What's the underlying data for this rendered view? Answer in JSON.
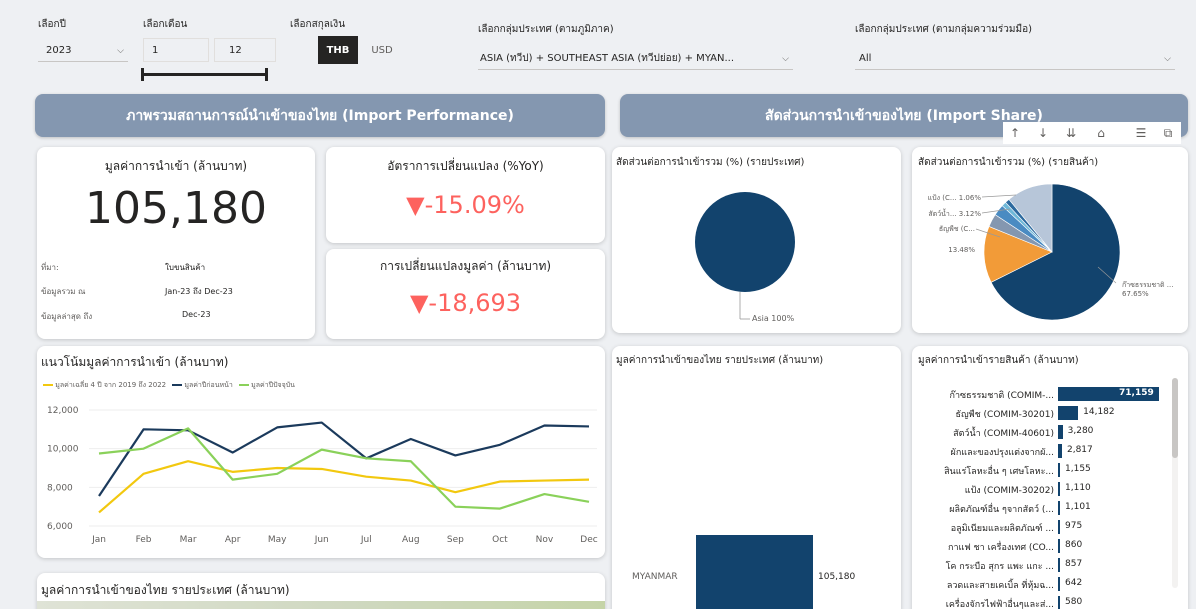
{
  "filters": {
    "year": {
      "label": "เลือกปี",
      "value": "2023"
    },
    "month": {
      "label": "เลือกเดือน",
      "from": "1",
      "to": "12"
    },
    "currency": {
      "label": "เลือกสกุลเงิน",
      "active": "THB",
      "inactive": "USD"
    },
    "region": {
      "label": "เลือกกลุ่มประเทศ (ตามภูมิภาค)",
      "value": "ASIA (ทวีป) + SOUTHEAST ASIA (ทวีปย่อย) + MYAN..."
    },
    "coop": {
      "label": "เลือกกลุ่มประเทศ (ตามกลุ่มความร่วมมือ)",
      "value": "All"
    }
  },
  "banners": {
    "left": "ภาพรวมสถานการณ์นำเข้าของไทย (Import Performance)",
    "right": "สัดส่วนการนำเข้าของไทย (Import Share)"
  },
  "kpi_value": {
    "title": "มูลค่าการนำเข้า (ล้านบาท)",
    "value": "105,180",
    "rows": [
      {
        "k": "ที่มา:",
        "v": "ใบขนสินค้า"
      },
      {
        "k": "ข้อมูลรวม ณ",
        "v": "Jan-23 ถึง Dec-23"
      },
      {
        "k": "ข้อมูลล่าสุด ถึง",
        "v": "Dec-23"
      }
    ]
  },
  "kpi_yoy": {
    "title": "อัตราการเปลี่ยนแปลง (%YoY)",
    "value": "▼-15.09%"
  },
  "kpi_change": {
    "title": "การเปลี่ยนแปลงมูลค่า (ล้านบาท)",
    "value": "▼-18,693"
  },
  "trend": {
    "title": "แนวโน้มมูลค่าการนำเข้า (ล้านบาท)",
    "legend": [
      "มูลค่าเฉลี่ย 4 ปี จาก 2019 ถึง 2022",
      "มูลค่าปีก่อนหน้า",
      "มูลค่าปีปัจจุบัน"
    ],
    "colors": [
      "#f2c80f",
      "#1b3a5c",
      "#8ad15a"
    ]
  },
  "pie_country": {
    "title": "สัดส่วนต่อการนำเข้ารวม (%) (รายประเทศ)",
    "label": "Asia 100%"
  },
  "pie_product": {
    "title": "สัดส่วนต่อการนำเข้ารวม (%) (รายสินค้า)",
    "labels": [
      "แป้ง (C... 1.06%",
      "สัตว์น้ำ... 3.12%",
      "ธัญพืช (C...",
      "13.48%",
      "ก๊าซธรรมชาติ ...",
      "67.65%"
    ]
  },
  "country_bar": {
    "title": "มูลค่าการนำเข้าของไทย รายประเทศ (ล้านบาท)",
    "category": "MYANMAR",
    "value_label": "105,180"
  },
  "product_bar": {
    "title": "มูลค่าการนำเข้ารายสินค้า (ล้านบาท)"
  },
  "map": {
    "title": "มูลค่าการนำเข้าของไทย รายประเทศ (ล้านบาท)"
  },
  "chart_data": [
    {
      "type": "line",
      "title": "แนวโน้มมูลค่าการนำเข้า (ล้านบาท)",
      "x": [
        "Jan",
        "Feb",
        "Mar",
        "Apr",
        "May",
        "Jun",
        "Jul",
        "Aug",
        "Sep",
        "Oct",
        "Nov",
        "Dec"
      ],
      "ylim": [
        6000,
        12000
      ],
      "yticks": [
        "12,000",
        "10,000",
        "8,000",
        "6,000"
      ],
      "series": [
        {
          "name": "มูลค่าเฉลี่ย 4 ปี จาก 2019 ถึง 2022",
          "color": "#f2c80f",
          "values": [
            6700,
            8700,
            9350,
            8800,
            9000,
            8950,
            8550,
            8350,
            7750,
            8300,
            8350,
            8400
          ]
        },
        {
          "name": "มูลค่าปีก่อนหน้า",
          "color": "#1b3a5c",
          "values": [
            7550,
            11000,
            10950,
            9800,
            11100,
            11350,
            9500,
            10500,
            9650,
            10200,
            11200,
            11150
          ]
        },
        {
          "name": "มูลค่าปีปัจจุบัน",
          "color": "#8ad15a",
          "values": [
            9750,
            10000,
            11050,
            8400,
            8700,
            9950,
            9500,
            9350,
            7000,
            6900,
            7650,
            7250
          ]
        }
      ],
      "grid": true
    },
    {
      "type": "pie",
      "title": "สัดส่วนต่อการนำเข้ารวม (%) (รายประเทศ)",
      "slices": [
        {
          "label": "Asia",
          "value": 100,
          "color": "#12436d"
        }
      ]
    },
    {
      "type": "pie",
      "title": "สัดส่วนต่อการนำเข้ารวม (%) (รายสินค้า)",
      "slices": [
        {
          "label": "ก๊าซธรรมชาติ ...",
          "value": 67.65,
          "color": "#12436d"
        },
        {
          "label": "ธัญพืช (C...",
          "value": 13.48,
          "color": "#f29b38"
        },
        {
          "label": "สัตว์น้ำ...",
          "value": 3.12,
          "color": "#8497b0"
        },
        {
          "label": "ผักและของปรุงแต่ง",
          "value": 2.68,
          "color": "#4a8bc2"
        },
        {
          "label": "สินแร่",
          "value": 1.1,
          "color": "#6fb8d8"
        },
        {
          "label": "แป้ง (C...",
          "value": 1.06,
          "color": "#2d6a9f"
        },
        {
          "label": "อื่นๆ",
          "value": 10.91,
          "color": "#b7c6d9"
        }
      ]
    },
    {
      "type": "bar",
      "title": "มูลค่าการนำเข้าของไทย รายประเทศ (ล้านบาท)",
      "categories": [
        "MYANMAR"
      ],
      "values": [
        105180
      ]
    },
    {
      "type": "bar",
      "title": "มูลค่าการนำเข้ารายสินค้า (ล้านบาท)",
      "categories": [
        "ก๊าซธรรมชาติ (COMIM-...",
        "ธัญพืช (COMIM-30201)",
        "สัตว์น้ำ (COMIM-40601)",
        "ผักและของปรุงแต่งจากผั...",
        "สินแร่โลหะอื่น ๆ เศษโลหะ...",
        "แป้ง (COMIM-30202)",
        "ผลิตภัณฑ์อื่น ๆจากสัตว์ (...",
        "อลูมิเนียมและผลิตภัณฑ์ ...",
        "กาแฟ ชา เครื่องเทศ (CO...",
        "โค กระบือ สุกร แพะ แกะ ...",
        "ลวดและสายเคเบิ้ล ที่หุ้มฉ...",
        "เครื่องจักรไฟฟ้าอื่นๆและส่..."
      ],
      "values": [
        71159,
        14182,
        3280,
        2817,
        1155,
        1110,
        1101,
        975,
        860,
        857,
        642,
        580
      ],
      "value_labels": [
        "71,159",
        "14,182",
        "3,280",
        "2,817",
        "1,155",
        "1,110",
        "1,101",
        "975",
        "860",
        "857",
        "642",
        "580"
      ]
    }
  ]
}
